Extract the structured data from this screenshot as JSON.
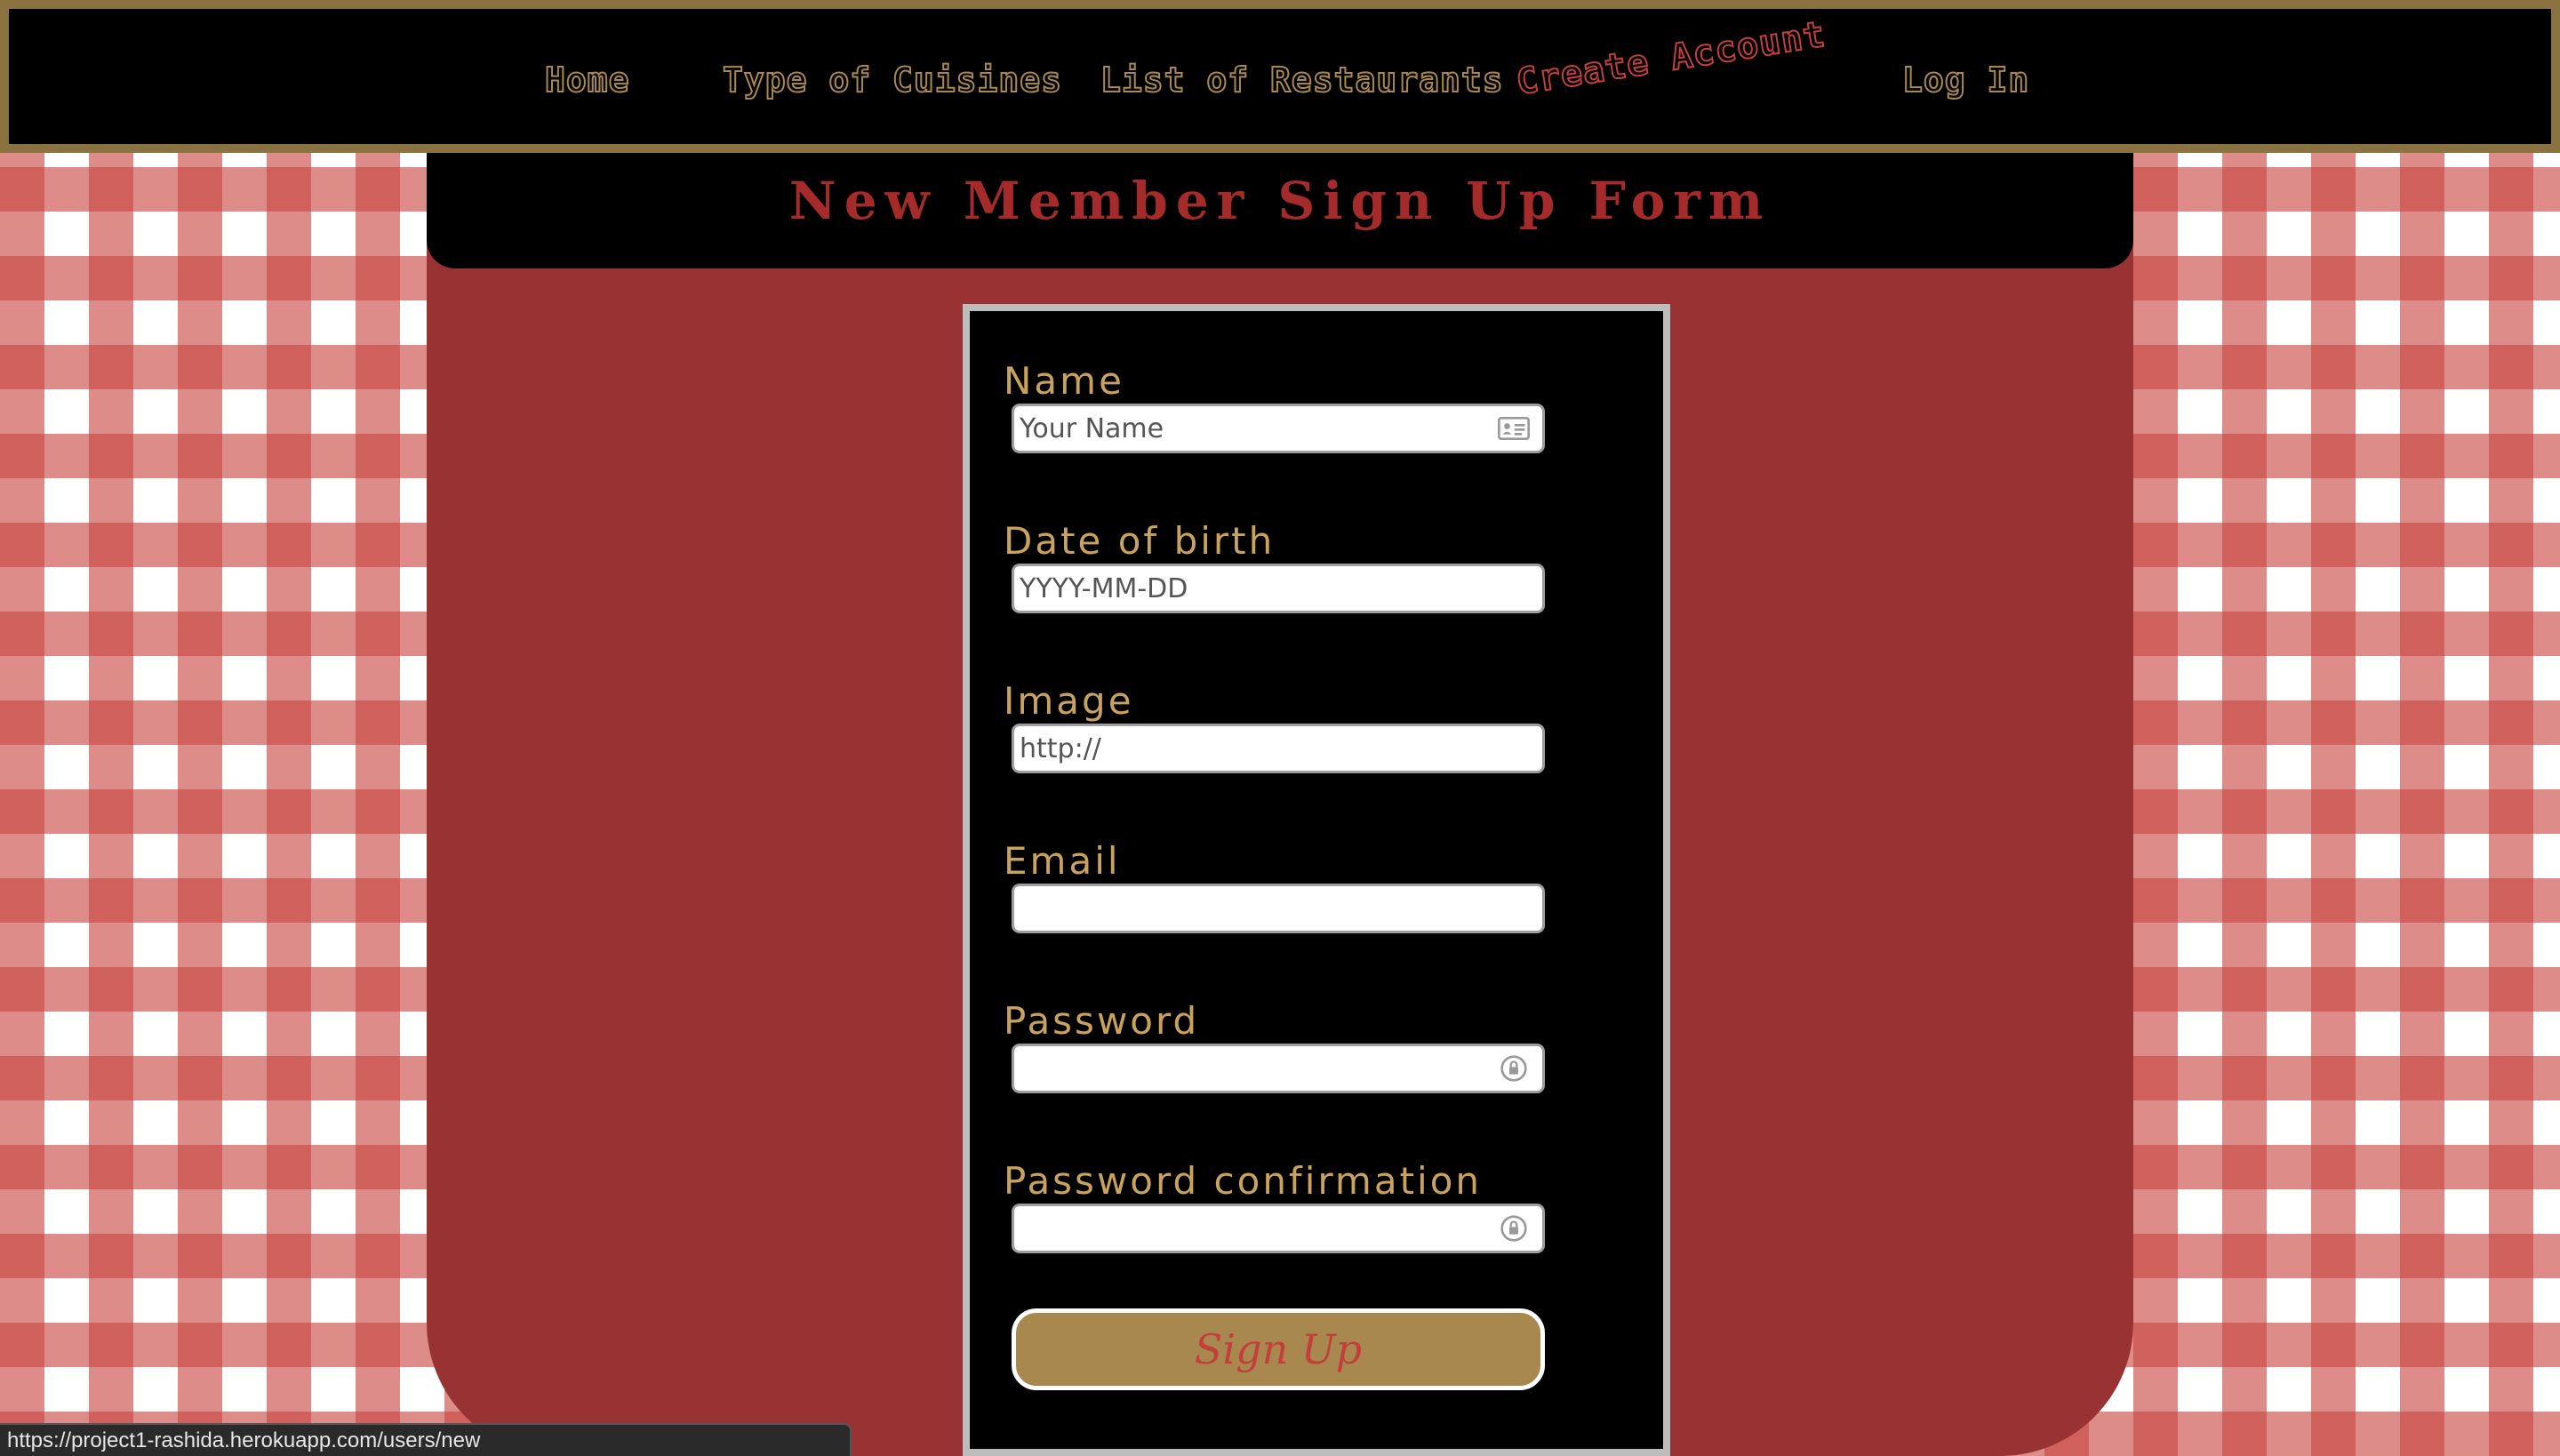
{
  "nav": {
    "items": [
      {
        "label": "Home"
      },
      {
        "label": "Type of Cuisines"
      },
      {
        "label": "List of Restaurants"
      },
      {
        "label": "Create Account"
      },
      {
        "label": "Log In"
      }
    ]
  },
  "page": {
    "title": "New Member Sign Up Form"
  },
  "form": {
    "fields": {
      "name": {
        "label": "Name",
        "placeholder": "Your Name",
        "value": "",
        "icon": "contact-card-icon"
      },
      "dob": {
        "label": "Date of birth",
        "placeholder": "YYYY-MM-DD",
        "value": ""
      },
      "image": {
        "label": "Image",
        "placeholder": "http://",
        "value": ""
      },
      "email": {
        "label": "Email",
        "placeholder": "",
        "value": ""
      },
      "password": {
        "label": "Password",
        "placeholder": "",
        "value": "",
        "icon": "password-key-icon"
      },
      "password_confirmation": {
        "label": "Password confirmation",
        "placeholder": "",
        "value": "",
        "icon": "password-key-icon"
      }
    },
    "submit_label": "Sign Up"
  },
  "status_bar": {
    "url": "https://project1-rashida.herokuapp.com/users/new"
  },
  "colors": {
    "nav_text": "#a8884f",
    "nav_active": "#c23f3b",
    "panel": "#993232",
    "title": "#a52a2a",
    "label": "#c9a35e",
    "button": "#a8884f"
  }
}
